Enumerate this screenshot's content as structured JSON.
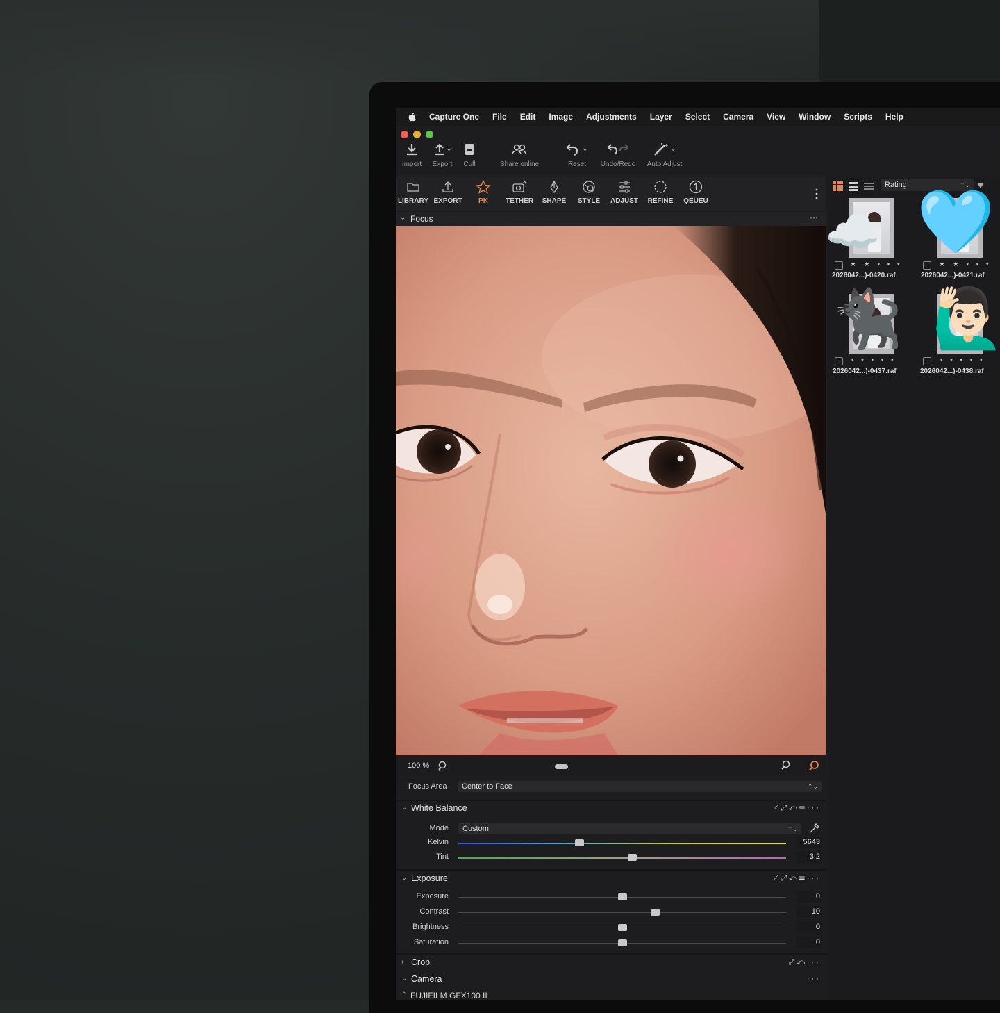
{
  "menubar": {
    "app": "Capture One",
    "items": [
      "File",
      "Edit",
      "Image",
      "Adjustments",
      "Layer",
      "Select",
      "Camera",
      "View",
      "Window",
      "Scripts",
      "Help"
    ]
  },
  "toolbar": {
    "import": "Import",
    "export": "Export",
    "cull": "Cull",
    "share": "Share online",
    "reset": "Reset",
    "undo_redo": "Undo/Redo",
    "auto_adjust": "Auto Adjust"
  },
  "tabs": [
    {
      "label": "LIBRARY",
      "icon": "folder-icon"
    },
    {
      "label": "EXPORT",
      "icon": "upload-icon"
    },
    {
      "label": "PK",
      "icon": "star-icon",
      "active": true
    },
    {
      "label": "TETHER",
      "icon": "camera-icon"
    },
    {
      "label": "SHAPE",
      "icon": "pen-nib-icon"
    },
    {
      "label": "STYLE",
      "icon": "palette-icon"
    },
    {
      "label": "ADJUST",
      "icon": "sliders-icon"
    },
    {
      "label": "REFINE",
      "icon": "aperture-icon"
    },
    {
      "label": "QEUEU",
      "icon": "number-one-icon"
    }
  ],
  "viewer": {
    "focus_title": "Focus",
    "zoom": "100 %",
    "focus_area_label": "Focus Area",
    "focus_area_value": "Center to Face"
  },
  "white_balance": {
    "title": "White Balance",
    "mode_label": "Mode",
    "mode_value": "Custom",
    "kelvin_label": "Kelvin",
    "kelvin_value": "5643",
    "kelvin_pos": 0.37,
    "tint_label": "Tint",
    "tint_value": "3.2",
    "tint_pos": 0.53
  },
  "exposure": {
    "title": "Exposure",
    "sliders": [
      {
        "label": "Exposure",
        "value": "0",
        "pos": 0.5
      },
      {
        "label": "Contrast",
        "value": "10",
        "pos": 0.6
      },
      {
        "label": "Brightness",
        "value": "0",
        "pos": 0.5
      },
      {
        "label": "Saturation",
        "value": "0",
        "pos": 0.5
      }
    ]
  },
  "crop": {
    "title": "Crop"
  },
  "camera": {
    "title": "Camera",
    "model": "FUJIFILM GFX100 II"
  },
  "browser": {
    "sort": "Rating",
    "thumbs": [
      {
        "name": "2026042...)-0420.raf",
        "stars": "★ ★ • • •",
        "emoji": "☁️"
      },
      {
        "name": "2026042...)-0421.raf",
        "stars": "★ ★ • • •",
        "emoji": "🩵"
      },
      {
        "name": "2026042...)-0437.raf",
        "stars": "• • • • •",
        "emoji": "🐈‍⬛"
      },
      {
        "name": "2026042...)-0438.raf",
        "stars": "• • • • •",
        "emoji": "🙋🏻‍♂️"
      }
    ]
  },
  "colors": {
    "accent": "#e8864a",
    "close": "#ec5f57",
    "minimize": "#e4b33c",
    "zoom": "#5fc24b"
  }
}
